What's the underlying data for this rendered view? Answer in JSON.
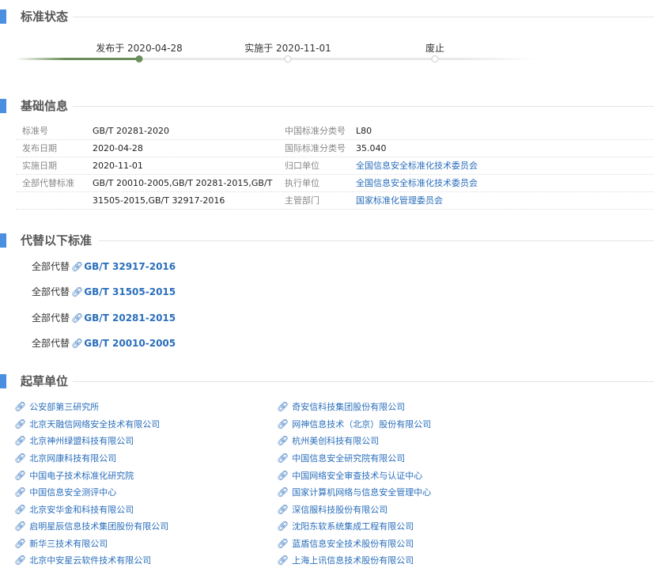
{
  "status": {
    "title": "标准状态",
    "steps": [
      {
        "label": "发布于 2020-04-28",
        "done": true
      },
      {
        "label": "实施于 2020-11-01",
        "done": false
      },
      {
        "label": "废止",
        "done": false
      }
    ]
  },
  "basic": {
    "title": "基础信息",
    "rows": [
      {
        "k1": "标准号",
        "v1": "GB/T 20281-2020",
        "k2": "中国标准分类号",
        "v2": "L80"
      },
      {
        "k1": "发布日期",
        "v1": "2020-04-28",
        "k2": "国际标准分类号",
        "v2": "35.040"
      },
      {
        "k1": "实施日期",
        "v1": "2020-11-01",
        "k2": "归口单位",
        "v2": "全国信息安全标准化技术委员会"
      },
      {
        "k1": "全部代替标准",
        "v1": "GB/T 20010-2005,GB/T 20281-2015,GB/T",
        "k2": "执行单位",
        "v2": "全国信息安全标准化技术委员会"
      },
      {
        "k1": "",
        "v1": "31505-2015,GB/T 32917-2016",
        "k2": "主管部门",
        "v2": "国家标准化管理委员会"
      }
    ]
  },
  "replaces": {
    "title": "代替以下标准",
    "items": [
      {
        "prefix": "全部代替",
        "code": "GB/T 32917-2016"
      },
      {
        "prefix": "全部代替",
        "code": "GB/T 31505-2015"
      },
      {
        "prefix": "全部代替",
        "code": "GB/T 20281-2015"
      },
      {
        "prefix": "全部代替",
        "code": "GB/T 20010-2005"
      }
    ]
  },
  "drafters": {
    "title": "起草单位",
    "left": [
      "公安部第三研究所",
      "北京天融信网络安全技术有限公司",
      "北京神州绿盟科技有限公司",
      "北京网康科技有限公司",
      "中国电子技术标准化研究院",
      "中国信息安全测评中心",
      "北京安华金和科技有限公司",
      "启明星辰信息技术集团股份有限公司",
      "新华三技术有限公司",
      "北京中安星云软件技术有限公司"
    ],
    "right": [
      "奇安信科技集团股份有限公司",
      "网神信息技术（北京）股份有限公司",
      "杭州美创科技有限公司",
      "中国信息安全研究院有限公司",
      "中国网络安全审查技术与认证中心",
      "国家计算机网络与信息安全管理中心",
      "深信服科技股份有限公司",
      "沈阳东软系统集成工程有限公司",
      "蓝盾信息安全技术股份有限公司",
      "上海上讯信息技术股份有限公司"
    ]
  },
  "icons": {
    "link": "link-icon"
  },
  "colors": {
    "accent": "#4a8fe0",
    "link": "#2a6ebb",
    "progress": "#6b8e5a"
  }
}
